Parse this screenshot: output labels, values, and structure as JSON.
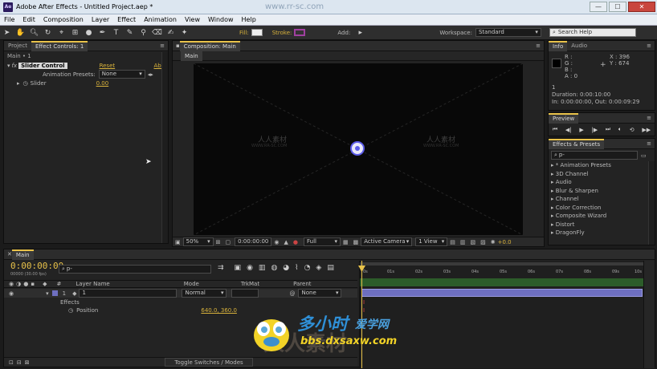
{
  "window": {
    "title": "Adobe After Effects - Untitled Project.aep *",
    "logo": "Ae",
    "buttons": [
      "minimize",
      "maximize",
      "close"
    ]
  },
  "menu": [
    "File",
    "Edit",
    "Composition",
    "Layer",
    "Effect",
    "Animation",
    "View",
    "Window",
    "Help"
  ],
  "toolbar": {
    "fill_label": "Fill:",
    "stroke_label": "Stroke:",
    "add_label": "Add:",
    "workspace_label": "Workspace:",
    "workspace_value": "Standard",
    "search_placeholder": "Search Help"
  },
  "left_panel": {
    "tabs": [
      "Project",
      "Effect Controls: 1"
    ],
    "breadcrumb": "Main • 1",
    "effect_prefix": "fx",
    "effect_name": "Slider Control",
    "reset_label": "Reset",
    "about_label": "Abo",
    "presets_label": "Animation Presets:",
    "presets_value": "None",
    "slider_label": "Slider",
    "slider_value": "0.00"
  },
  "comp_panel": {
    "tab": "Composition: Main",
    "subtab": "Main",
    "zoom": "50%",
    "timecode": "0:00:00:00",
    "resolution": "Full",
    "camera": "Active Camera",
    "views": "1 View",
    "exposure": "+0.0",
    "watermark_main": "人人素材",
    "watermark_sub": "WWW.RR-SC.COM"
  },
  "info_panel": {
    "tabs": [
      "Info",
      "Audio"
    ],
    "r": "R :",
    "g": "G :",
    "b": "B :",
    "a": "A : 0",
    "x": "X : 396",
    "y": "Y : 674",
    "layer": "1",
    "duration": "Duration: 0:00:10:00",
    "inout": "In: 0:00:00:00, Out: 0:00:09:29"
  },
  "preview_panel": {
    "tab": "Preview"
  },
  "effects_panel": {
    "tab": "Effects & Presets",
    "search_placeholder": "p-",
    "items": [
      "* Animation Presets",
      "3D Channel",
      "Audio",
      "Blur & Sharpen",
      "Channel",
      "Color Correction",
      "Composite Wizard",
      "Distort",
      "DragonFly"
    ]
  },
  "timeline": {
    "tab": "Main",
    "timecode": "0:00:00:00",
    "fps": "00000 (30.00 fps)",
    "search_placeholder": "p-",
    "col_layer": "Layer Name",
    "col_mode": "Mode",
    "col_trkmat": "TrkMat",
    "col_parent": "Parent",
    "layer_num": "1",
    "layer_name": "1",
    "mode_value": "Normal",
    "parent_value": "None",
    "effects_label": "Effects",
    "position_label": "Position",
    "position_value": "640.0, 360.0",
    "ruler": [
      "0s",
      "01s",
      "02s",
      "03s",
      "04s",
      "05s",
      "06s",
      "07s",
      "08s",
      "09s",
      "10s"
    ],
    "toggle_label": "Toggle Switches / Modes"
  },
  "overlay_watermark": {
    "title": "多小时",
    "subtitle": "爱学网",
    "url": "bbs.dxsaxw.com",
    "bg_text": "人人素材"
  },
  "site_watermark": "www.rr-sc.com",
  "colors": {
    "accent_yellow": "#e8c24a",
    "layer_bar": "#6e6fc0",
    "timeline_green": "#2c5c2a"
  }
}
